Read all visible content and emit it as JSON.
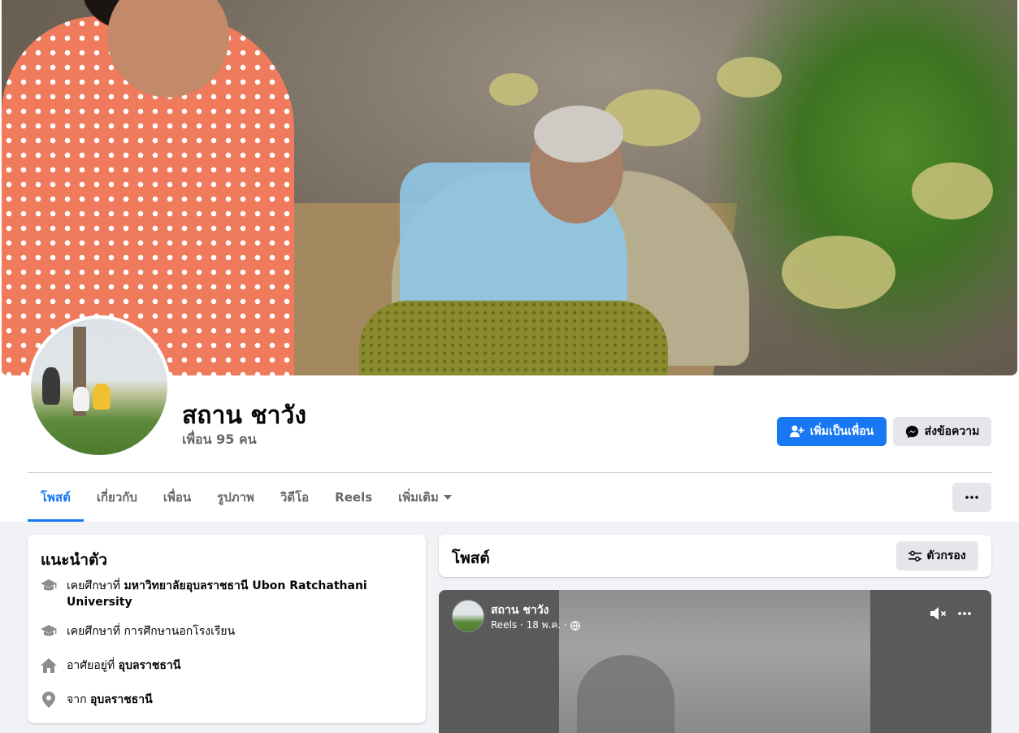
{
  "profile": {
    "name": "สถาน ชาวัง",
    "friends_text": "เพื่อน 95 คน"
  },
  "actions": {
    "add_friend": "เพิ่มเป็นเพื่อน",
    "message": "ส่งข้อความ"
  },
  "tabs": [
    {
      "label": "โพสต์",
      "active": true
    },
    {
      "label": "เกี่ยวกับ",
      "active": false
    },
    {
      "label": "เพื่อน",
      "active": false
    },
    {
      "label": "รูปภาพ",
      "active": false
    },
    {
      "label": "วิดีโอ",
      "active": false
    },
    {
      "label": "Reels",
      "active": false
    },
    {
      "label": "เพิ่มเติม",
      "active": false
    }
  ],
  "intro": {
    "title": "แนะนำตัว",
    "items": [
      {
        "icon": "graduation-cap-icon",
        "prefix": "เคยศึกษาที่ ",
        "value": "มหาวิทยาลัยอุบลราชธานี Ubon Ratchathani University"
      },
      {
        "icon": "graduation-cap-icon",
        "prefix": "เคยศึกษาที่ การศึกษานอกโรงเรียน",
        "value": ""
      },
      {
        "icon": "home-icon",
        "prefix": "อาศัยอยู่ที่ ",
        "value": "อุบลราชธานี"
      },
      {
        "icon": "location-pin-icon",
        "prefix": "จาก ",
        "value": "อุบลราชธานี"
      }
    ]
  },
  "posts": {
    "title": "โพสต์",
    "filter_label": "ตัวกรอง"
  },
  "reel": {
    "author": "สถาน ชาวัง",
    "meta": "Reels · 18 พ.ค. ·"
  },
  "colors": {
    "accent": "#1877f2",
    "page_bg": "#f0f2f5",
    "secondary_button": "#e4e6eb",
    "muted_text": "#65676b"
  }
}
